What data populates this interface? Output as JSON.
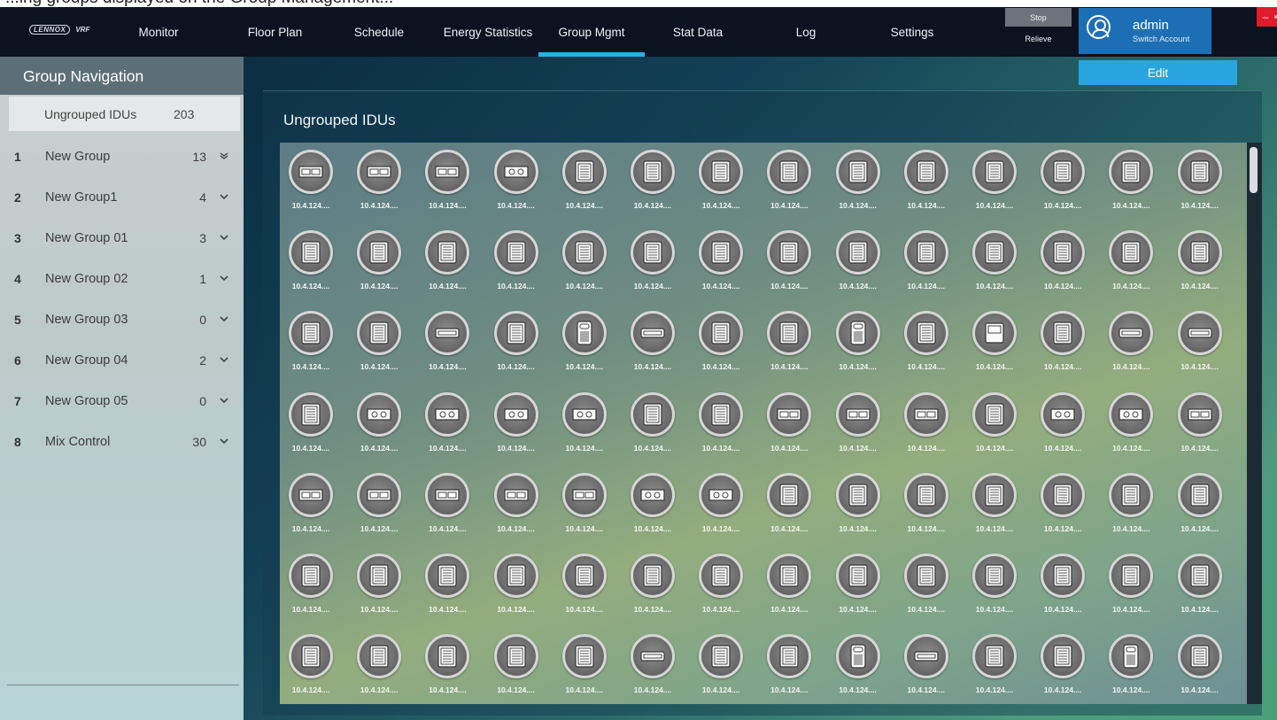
{
  "caption": "...ing groups displayed on the Group Management...",
  "app": {
    "brand": "LENNOX",
    "brand_suffix": "VRF"
  },
  "nav": [
    {
      "label": "Monitor",
      "active": false
    },
    {
      "label": "Floor Plan",
      "active": false
    },
    {
      "label": "Schedule",
      "active": false
    },
    {
      "label": "Energy Statistics",
      "active": false
    },
    {
      "label": "Group Mgmt",
      "active": true
    },
    {
      "label": "Stat Data",
      "active": false
    },
    {
      "label": "Log",
      "active": false
    },
    {
      "label": "Settings",
      "active": false
    }
  ],
  "controls": {
    "stop": "Stop",
    "relieve": "Relieve"
  },
  "account": {
    "name": "admin",
    "switch_label": "Switch Account"
  },
  "window": {
    "minimize": "–",
    "close": "×"
  },
  "sidebar": {
    "title": "Group Navigation",
    "ungrouped": {
      "label": "Ungrouped IDUs",
      "count": "203"
    },
    "groups": [
      {
        "num": "1",
        "label": "New Group",
        "count": "13"
      },
      {
        "num": "2",
        "label": "New Group1",
        "count": "4"
      },
      {
        "num": "3",
        "label": "New Group 01",
        "count": "3"
      },
      {
        "num": "4",
        "label": "New Group 02",
        "count": "1"
      },
      {
        "num": "5",
        "label": "New Group 03",
        "count": "0"
      },
      {
        "num": "6",
        "label": "New Group 04",
        "count": "2"
      },
      {
        "num": "7",
        "label": "New Group 05",
        "count": "0"
      },
      {
        "num": "8",
        "label": "Mix Control",
        "count": "30"
      }
    ]
  },
  "main": {
    "edit_label": "Edit",
    "panel_title": "Ungrouped IDUs",
    "ip_label": "10.4.124....",
    "idu_rows": [
      [
        "duct",
        "duct",
        "duct",
        "cassette",
        "square",
        "square",
        "square",
        "square",
        "square",
        "square",
        "square",
        "square",
        "square",
        "square"
      ],
      [
        "square",
        "square",
        "square",
        "square",
        "square",
        "square",
        "square",
        "square",
        "square",
        "square",
        "square",
        "square",
        "square",
        "square"
      ],
      [
        "square",
        "square",
        "wall",
        "square",
        "floor",
        "wall",
        "square",
        "square",
        "floor",
        "square",
        "small-panel",
        "square",
        "wall",
        "wall"
      ],
      [
        "square",
        "cassette",
        "cassette",
        "cassette",
        "cassette",
        "square",
        "square",
        "duct",
        "duct",
        "duct",
        "square",
        "cassette",
        "cassette",
        "duct"
      ],
      [
        "duct",
        "duct",
        "duct",
        "duct",
        "duct",
        "cassette",
        "cassette",
        "square",
        "square",
        "square",
        "square",
        "square",
        "square",
        "square"
      ],
      [
        "square",
        "square",
        "square",
        "square",
        "square",
        "square",
        "square",
        "square",
        "square",
        "square",
        "square",
        "square",
        "square",
        "square"
      ],
      [
        "square",
        "square",
        "square",
        "square",
        "square",
        "wall",
        "square",
        "square",
        "floor",
        "wall",
        "square",
        "square",
        "floor",
        "square"
      ]
    ]
  }
}
